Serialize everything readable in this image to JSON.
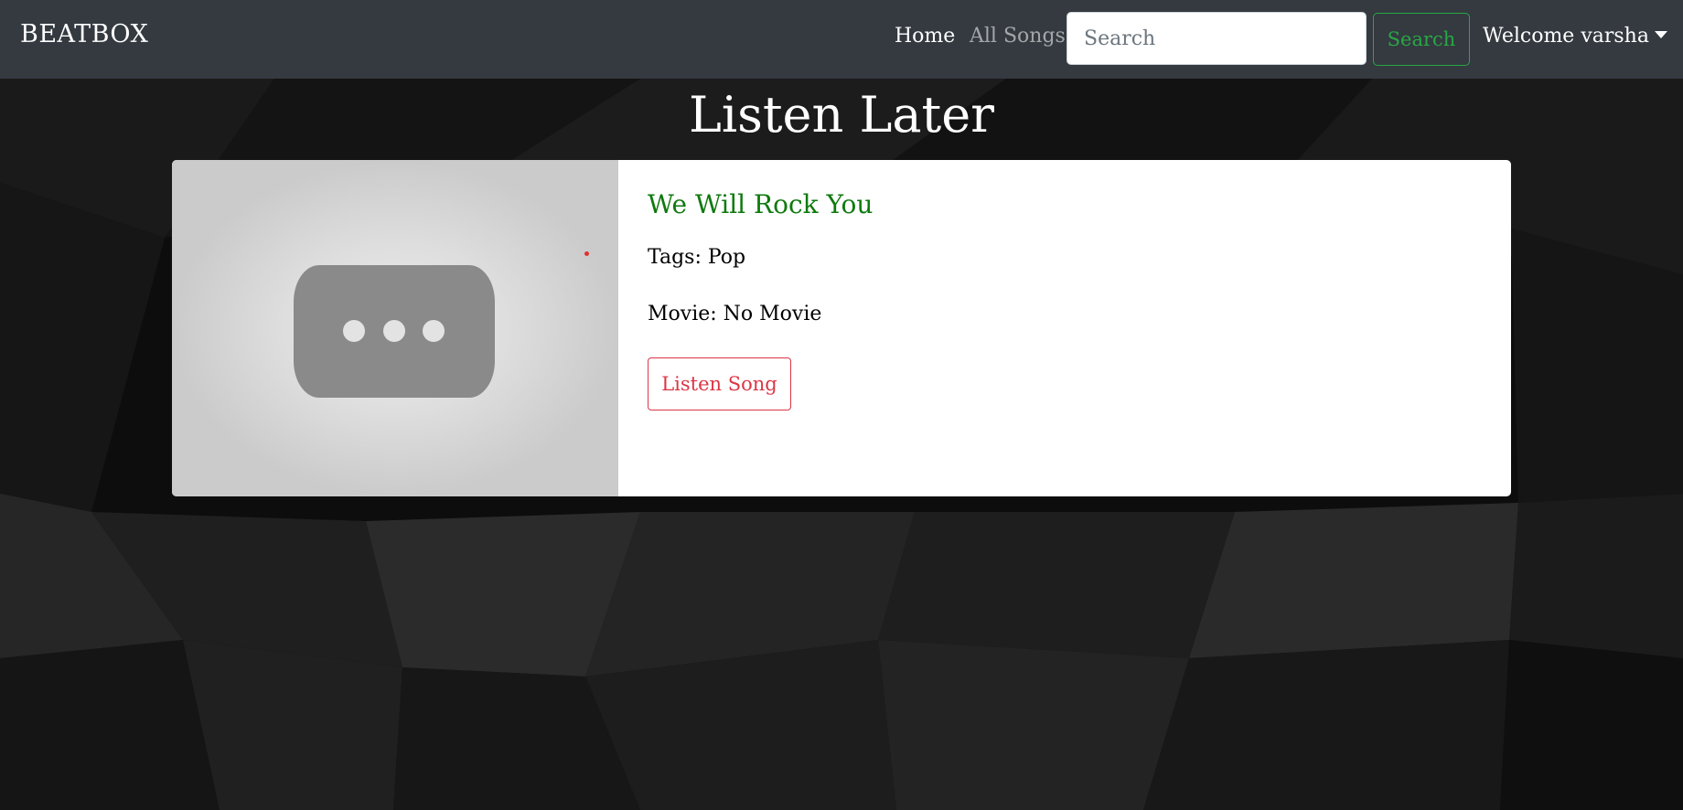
{
  "navbar": {
    "brand": "BEATBOX",
    "links": [
      {
        "label": "Home"
      },
      {
        "label": "All Songs"
      }
    ],
    "search": {
      "placeholder": "Search",
      "value": "",
      "button_label": "Search"
    },
    "user_menu": {
      "label": "Welcome varsha",
      "icon": "caret-down-icon"
    }
  },
  "page": {
    "title": "Listen Later"
  },
  "songs": [
    {
      "title": "We Will Rock You",
      "tags_label": "Tags:",
      "tags": "Pop",
      "movie_label": "Movie:",
      "movie": "No Movie",
      "button_label": "Listen Song",
      "thumbnail_icon": "video-placeholder-icon"
    }
  ],
  "colors": {
    "navbar_bg": "#343a40",
    "song_title": "#0f7a0f",
    "search_button": "#28a745",
    "listen_button": "#dc3545"
  }
}
